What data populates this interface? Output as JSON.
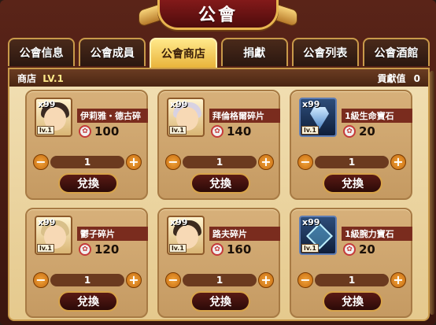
{
  "title": "公會",
  "tabs": [
    {
      "label": "公會信息",
      "active": false
    },
    {
      "label": "公會成員",
      "active": false
    },
    {
      "label": "公會商店",
      "active": true
    },
    {
      "label": "捐獻",
      "active": false
    },
    {
      "label": "公會列表",
      "active": false
    },
    {
      "label": "公會酒館",
      "active": false
    }
  ],
  "shop": {
    "label": "商店",
    "level": "LV.1",
    "contribution_label": "貢獻值",
    "contribution_value": "0"
  },
  "items": [
    {
      "name": "伊莉雅・德古碎",
      "qty": "x99",
      "level": "lv.1",
      "price": "100",
      "count": "1",
      "exchange_label": "兌換",
      "kind": "hero",
      "hair_color": "#3a2a22"
    },
    {
      "name": "拜倫格爾碎片",
      "qty": "x99",
      "level": "lv.1",
      "price": "140",
      "count": "1",
      "exchange_label": "兌換",
      "kind": "hero",
      "hair_color": "#d8d2e2"
    },
    {
      "name": "1級生命寶石",
      "qty": "x99",
      "level": "lv.1",
      "price": "20",
      "count": "1",
      "exchange_label": "兌換",
      "kind": "gem-life"
    },
    {
      "name": "鬱子碎片",
      "qty": "x99",
      "level": "lv.1",
      "price": "120",
      "count": "1",
      "exchange_label": "兌換",
      "kind": "hero",
      "hair_color": "#d9c08a"
    },
    {
      "name": "路夫碎片",
      "qty": "x99",
      "level": "lv.1",
      "price": "160",
      "count": "1",
      "exchange_label": "兌換",
      "kind": "hero",
      "hair_color": "#3b2a1e"
    },
    {
      "name": "1級腕力寶石",
      "qty": "x99",
      "level": "lv.1",
      "price": "20",
      "count": "1",
      "exchange_label": "兌換",
      "kind": "gem-power"
    }
  ],
  "icons": {
    "minus": "−",
    "plus": "+",
    "currency": "✿"
  },
  "colors": {
    "accent_gold": "#e9b43b",
    "panel": "#e5c98d",
    "name_bar": "#7a2c1e"
  }
}
